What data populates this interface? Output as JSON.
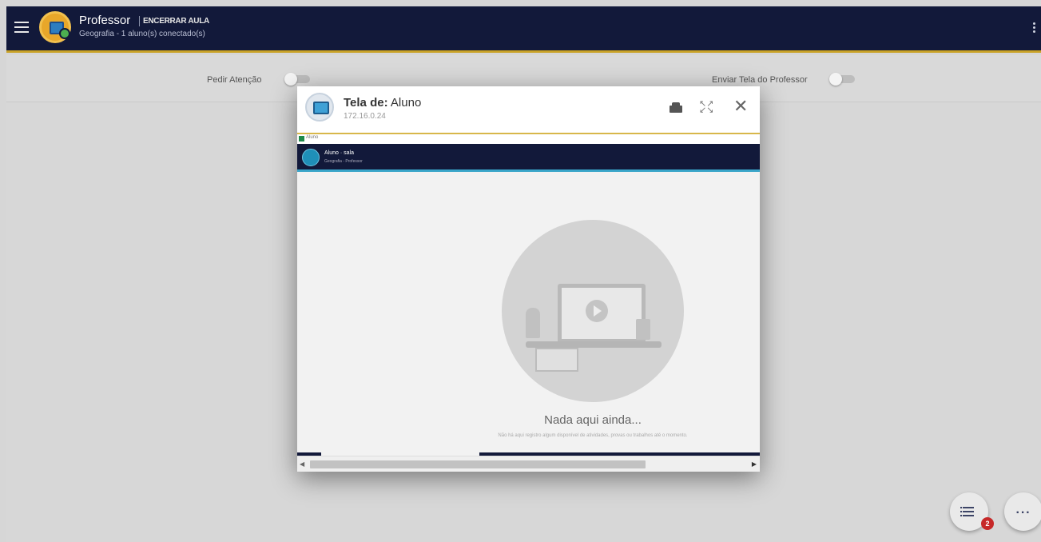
{
  "header": {
    "title": "Professor",
    "end_class_label": "ENCERRAR AULA",
    "subtitle": "Geografia - 1 aluno(s) conectado(s)"
  },
  "toggles": {
    "attention_label": "Pedir Atenção",
    "send_screen_label": "Enviar Tela do Professor"
  },
  "modal": {
    "title_prefix": "Tela de:",
    "title_name": "Aluno",
    "ip": "172.16.0.24"
  },
  "remote": {
    "tab_text": "Aluno",
    "user_name": "Aluno · sala",
    "user_sub": "Geografia - Professor",
    "empty_title": "Nada aqui ainda...",
    "empty_text": "Não há aqui registro algum disponível de atividades, provas ou trabalhos até o momento."
  },
  "fab": {
    "badge_count": "2",
    "more_label": "···"
  },
  "colors": {
    "topbar": "#12193a",
    "accent": "#c9a227",
    "badge": "#c62828"
  }
}
